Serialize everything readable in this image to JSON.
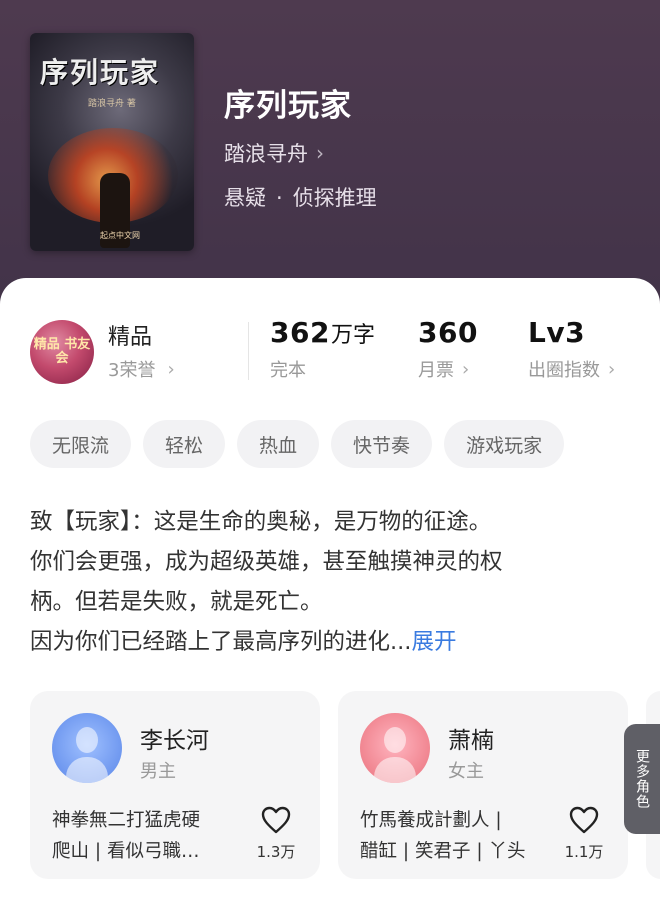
{
  "header": {
    "cover": {
      "title_art": "序列玩家",
      "subtitle_art": "踏浪寻舟 著",
      "foot_art": "起点中文网"
    },
    "title": "序列玩家",
    "author": "踏浪寻舟",
    "genre_1": "悬疑",
    "genre_sep": "·",
    "genre_2": "侦探推理"
  },
  "stats": {
    "badge_art": "精品 书友会",
    "badge_label": "精品",
    "badge_honor": "3荣誉",
    "words_num": "362",
    "words_unit": "万字",
    "words_status": "完本",
    "votes_num": "360",
    "votes_label": "月票",
    "level_num": "Lv3",
    "level_label": "出圈指数"
  },
  "tags": [
    "无限流",
    "轻松",
    "热血",
    "快节奏",
    "游戏玩家"
  ],
  "description": {
    "lines": [
      "致【玩家】：这是生命的奥秘，是万物的征途。",
      "你们会更强，成为超级英雄，甚至触摸神灵的权",
      "柄。但若是失败，就是死亡。",
      "因为你们已经踏上了最高序列的进化..."
    ],
    "expand": "展开"
  },
  "characters": [
    {
      "name": "李长河",
      "role": "男主",
      "desc_1": "神拳無二打猛虎硬",
      "desc_2": "爬山 | 看似弓職…",
      "likes": "1.3万"
    },
    {
      "name": "萧楠",
      "role": "女主",
      "desc_1": "竹馬養成計劃人 |",
      "desc_2": "醋缸 | 笑君子 | 丫头",
      "likes": "1.1万"
    }
  ],
  "more_roles": "更多角色",
  "icons": {
    "chevron": "chevron-right-icon",
    "heart": "heart-outline-icon"
  },
  "colors": {
    "header_bg": "#4e3a4f",
    "link_blue": "#3a7be0",
    "tag_bg": "#f2f2f4"
  }
}
